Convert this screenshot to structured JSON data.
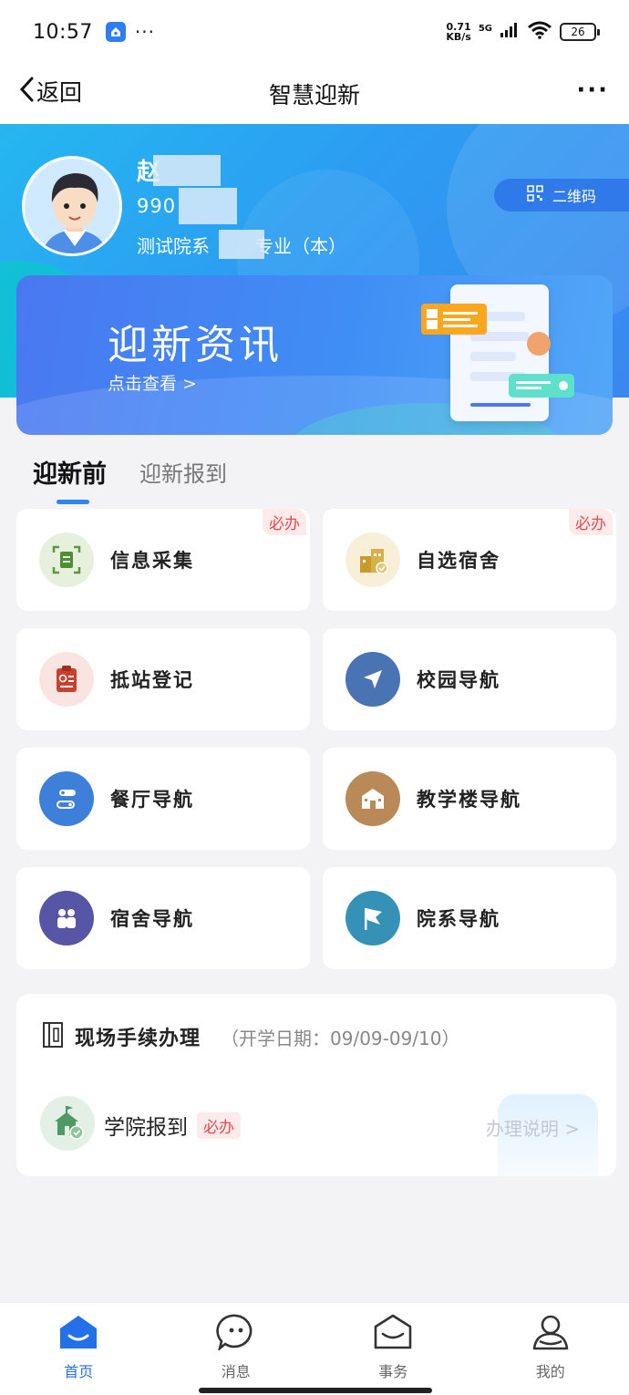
{
  "status_bar": {
    "time": "10:57",
    "dots": "···",
    "net_speed_value": "0.71",
    "net_speed_unit": "KB/s",
    "network": "5G",
    "battery": "26"
  },
  "nav": {
    "back_label": "返回",
    "title": "智慧迎新",
    "more": "···"
  },
  "profile": {
    "name": "赵",
    "student_id": "990",
    "department": "测试院系",
    "major_suffix": "专业（本）",
    "qr_label": "二维码"
  },
  "banner": {
    "title": "迎新资讯",
    "link": "点击查看 >"
  },
  "tabs": {
    "active": "迎新前",
    "inactive": "迎新报到"
  },
  "services": [
    {
      "label": "信息采集",
      "badge": "必办",
      "icon": "id-card-icon",
      "color": "#6aa84f"
    },
    {
      "label": "自选宿舍",
      "badge": "必办",
      "icon": "building-icon",
      "color": "#d8b04a"
    },
    {
      "label": "抵站登记",
      "badge": "",
      "icon": "clipboard-icon",
      "color": "#d64b3a"
    },
    {
      "label": "校园导航",
      "badge": "",
      "icon": "navigation-arrow-icon",
      "color": "#4a73b4"
    },
    {
      "label": "餐厅导航",
      "badge": "",
      "icon": "route-icon",
      "color": "#3d7fd9"
    },
    {
      "label": "教学楼导航",
      "badge": "",
      "icon": "school-building-icon",
      "color": "#b98a57"
    },
    {
      "label": "宿舍导航",
      "badge": "",
      "icon": "people-icon",
      "color": "#5756a6"
    },
    {
      "label": "院系导航",
      "badge": "",
      "icon": "flag-icon",
      "color": "#3592b6"
    }
  ],
  "onsite": {
    "title": "现场手续办理",
    "date": "（开学日期：09/09-09/10）",
    "item_label": "学院报到",
    "item_badge": "必办",
    "instructions": "办理说明 >"
  },
  "tabbar": [
    {
      "label": "首页",
      "icon": "home-icon",
      "active": true
    },
    {
      "label": "消息",
      "icon": "message-icon",
      "active": false
    },
    {
      "label": "事务",
      "icon": "envelope-icon",
      "active": false
    },
    {
      "label": "我的",
      "icon": "user-icon",
      "active": false
    }
  ]
}
